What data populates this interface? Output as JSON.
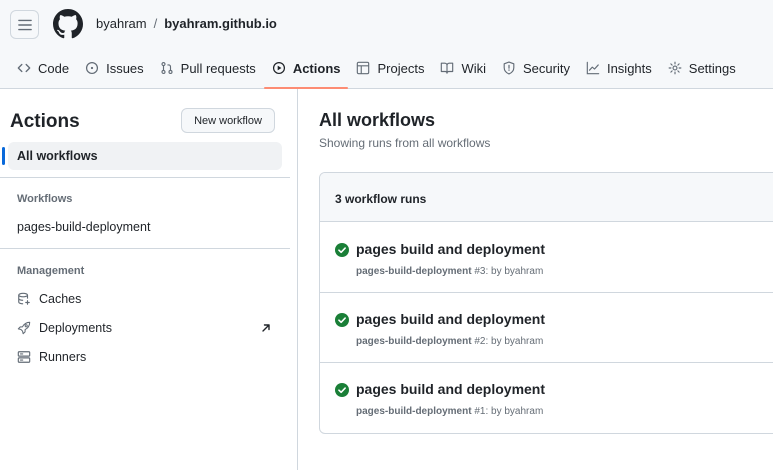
{
  "header": {
    "owner": "byahram",
    "separator": "/",
    "repo": "byahram.github.io"
  },
  "tabs": [
    {
      "label": "Code",
      "icon": "code-icon"
    },
    {
      "label": "Issues",
      "icon": "issue-opened-icon"
    },
    {
      "label": "Pull requests",
      "icon": "git-pull-request-icon"
    },
    {
      "label": "Actions",
      "icon": "play-icon",
      "active": true
    },
    {
      "label": "Projects",
      "icon": "table-icon"
    },
    {
      "label": "Wiki",
      "icon": "book-icon"
    },
    {
      "label": "Security",
      "icon": "shield-icon"
    },
    {
      "label": "Insights",
      "icon": "graph-icon"
    },
    {
      "label": "Settings",
      "icon": "gear-icon"
    }
  ],
  "sidebar": {
    "title": "Actions",
    "new_workflow_label": "New workflow",
    "all_workflows_label": "All workflows",
    "workflows_heading": "Workflows",
    "workflows": [
      "pages-build-deployment"
    ],
    "management_heading": "Management",
    "management_items": [
      {
        "label": "Caches",
        "icon": "cache-icon"
      },
      {
        "label": "Deployments",
        "icon": "rocket-icon",
        "external": true
      },
      {
        "label": "Runners",
        "icon": "server-icon"
      }
    ]
  },
  "main": {
    "title": "All workflows",
    "subtitle": "Showing runs from all workflows",
    "runs_count": "3 workflow runs",
    "runs": [
      {
        "title": "pages build and deployment",
        "workflow": "pages-build-deployment",
        "run_number": "#3",
        "by": ": by byahram",
        "status": "success"
      },
      {
        "title": "pages build and deployment",
        "workflow": "pages-build-deployment",
        "run_number": "#2",
        "by": ": by byahram",
        "status": "success"
      },
      {
        "title": "pages build and deployment",
        "workflow": "pages-build-deployment",
        "run_number": "#1",
        "by": ": by byahram",
        "status": "success"
      }
    ]
  },
  "colors": {
    "accent_underline": "#fd8c73",
    "active_indicator": "#0969da",
    "success": "#1a7f37",
    "border": "#d0d7de"
  }
}
